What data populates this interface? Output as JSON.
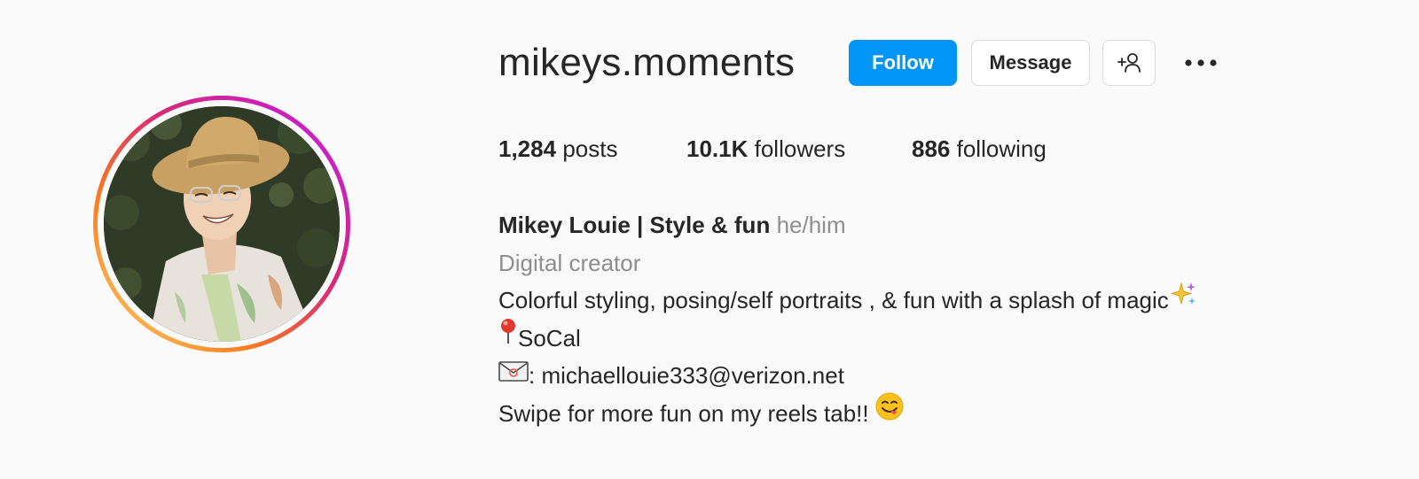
{
  "profile": {
    "username": "mikeys.moments",
    "buttons": {
      "follow": "Follow",
      "message": "Message"
    },
    "stats": {
      "posts_count": "1,284",
      "posts_label": "posts",
      "followers_count": "10.1K",
      "followers_label": "followers",
      "following_count": "886",
      "following_label": "following"
    },
    "bio": {
      "full_name": "Mikey Louie | Style & fun",
      "pronouns": "he/him",
      "category": "Digital creator",
      "line1": "Colorful styling, posing/self portraits , & fun with a splash of magic",
      "line2": "SoCal",
      "line3": ": michaellouie333@verizon.net",
      "line4": "Swipe for more fun on my reels tab!! "
    }
  },
  "icons": {
    "avatar": "profile-photo",
    "add_user": "person-add-icon",
    "more": "more-options-icon",
    "sparkles": "sparkles-emoji",
    "pin": "round-pushpin-emoji",
    "envelope": "envelope-emoji",
    "yum": "face-savoring-food-emoji"
  },
  "colors": {
    "follow_button": "#0095f6",
    "muted_text": "#8e8e8e",
    "primary_text": "#262626",
    "background": "#fafafa"
  }
}
